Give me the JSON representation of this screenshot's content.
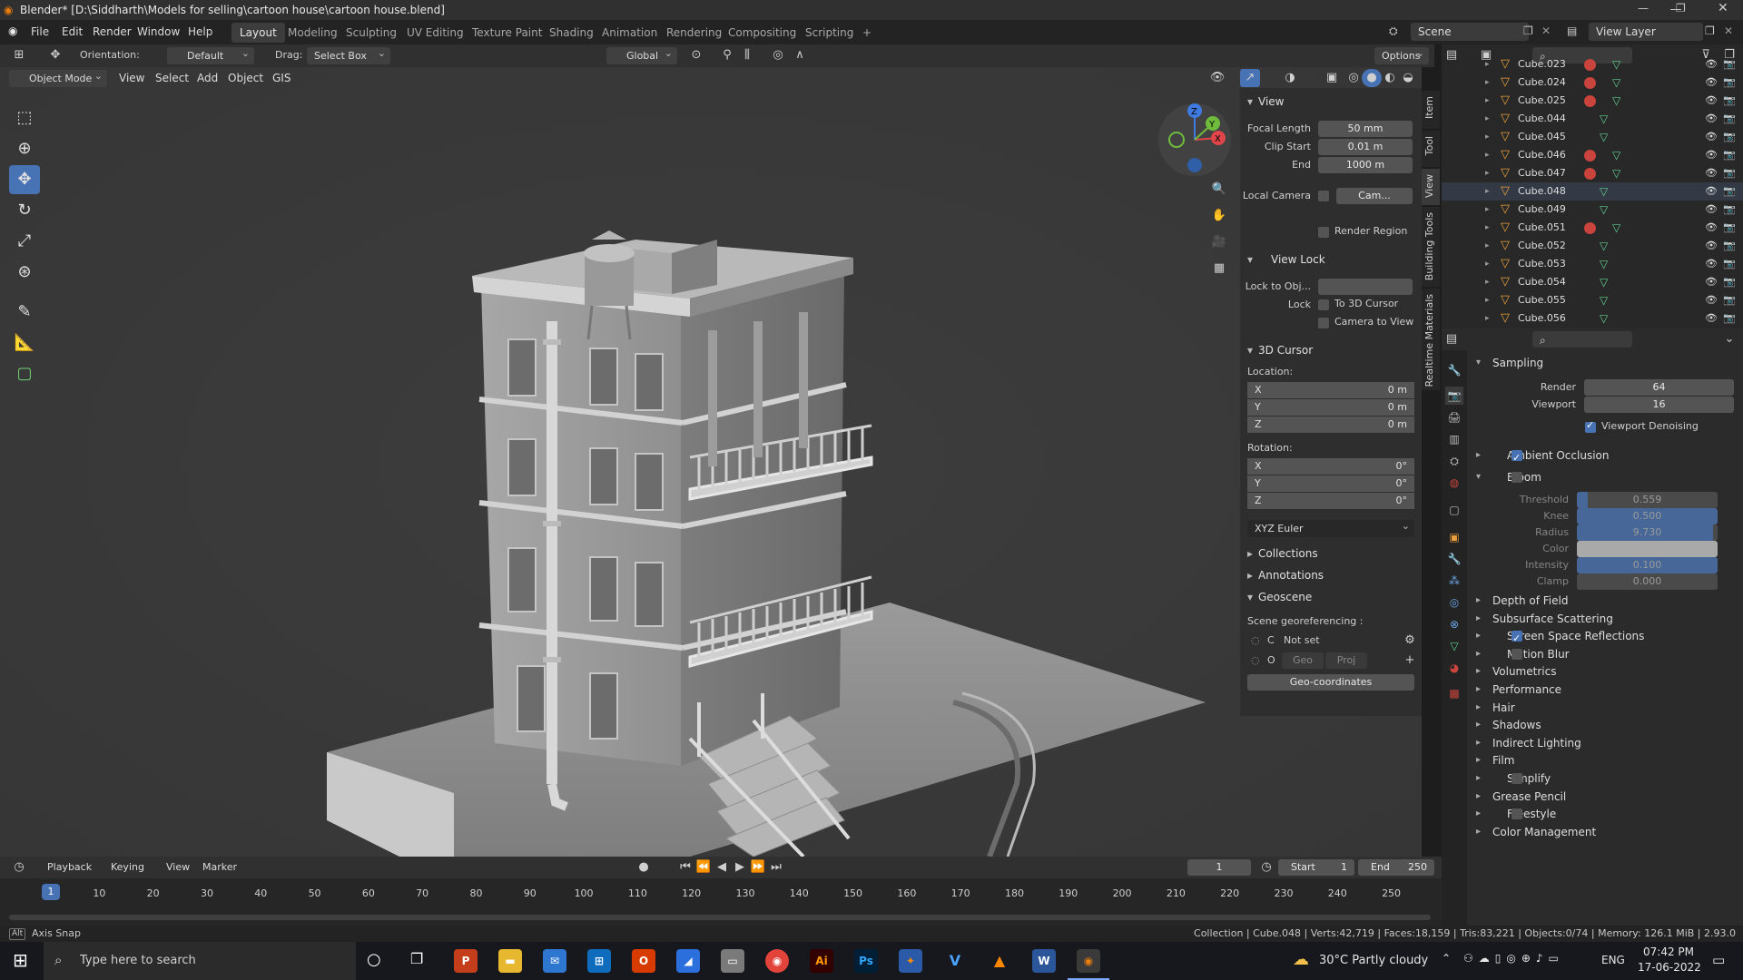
{
  "window": {
    "title": "Blender* [D:\\Siddharth\\Models for selling\\cartoon house\\cartoon house.blend]",
    "controls": [
      "minimize-icon",
      "restore-icon",
      "close-icon"
    ]
  },
  "menubar": {
    "items": [
      "File",
      "Edit",
      "Render",
      "Window",
      "Help"
    ],
    "workspaces": [
      "Layout",
      "Modeling",
      "Sculpting",
      "UV Editing",
      "Texture Paint",
      "Shading",
      "Animation",
      "Rendering",
      "Compositing",
      "Scripting",
      "+"
    ],
    "active_workspace": "Layout",
    "scene": "Scene",
    "view_layer": "View Layer"
  },
  "tool_header": {
    "orientation_label": "Orientation:",
    "orientation_value": "Default",
    "drag_label": "Drag:",
    "drag_value": "Select Box",
    "transform_orientation": "Global",
    "options": "Options"
  },
  "viewport_header": {
    "mode": "Object Mode",
    "menus": [
      "View",
      "Select",
      "Add",
      "Object",
      "GIS"
    ]
  },
  "npanel": {
    "view_section": "View",
    "focal_length_label": "Focal Length",
    "focal_length": "50 mm",
    "clip_start_label": "Clip Start",
    "clip_start": "0.01 m",
    "end_label": "End",
    "end": "1000 m",
    "local_camera_label": "Local Camera",
    "local_camera_value": "Cam...",
    "render_region": "Render Region",
    "view_lock_section": "View Lock",
    "lock_to_obj_label": "Lock to Obj...",
    "lock_label": "Lock",
    "to_3d_cursor": "To 3D Cursor",
    "camera_to_view": "Camera to View",
    "cursor_section": "3D Cursor",
    "location_label": "Location:",
    "location": [
      {
        "axis": "X",
        "value": "0 m"
      },
      {
        "axis": "Y",
        "value": "0 m"
      },
      {
        "axis": "Z",
        "value": "0 m"
      }
    ],
    "rotation_label": "Rotation:",
    "rotation": [
      {
        "axis": "X",
        "value": "0°"
      },
      {
        "axis": "Y",
        "value": "0°"
      },
      {
        "axis": "Z",
        "value": "0°"
      }
    ],
    "rotation_mode": "XYZ Euler",
    "collections": "Collections",
    "annotations": "Annotations",
    "geoscene": "Geoscene",
    "scene_georef": "Scene georeferencing :",
    "crs_letter": "C",
    "crs_value": "Not set",
    "origin_letter": "O",
    "geo_btn": "Geo",
    "proj_btn": "Proj",
    "geo_coordinates": "Geo-coordinates",
    "side_tabs": [
      "Item",
      "Tool",
      "View",
      "Building Tools",
      "Realtime Materials"
    ]
  },
  "outliner": {
    "rows": [
      {
        "name": "Cube.023",
        "mat": true,
        "mesh2": true
      },
      {
        "name": "Cube.024",
        "mat": true,
        "mesh2": true
      },
      {
        "name": "Cube.025",
        "mat": true,
        "mesh2": true
      },
      {
        "name": "Cube.044",
        "mat": false,
        "mesh2": false
      },
      {
        "name": "Cube.045",
        "mat": false,
        "mesh2": false
      },
      {
        "name": "Cube.046",
        "mat": true,
        "mesh2": true
      },
      {
        "name": "Cube.047",
        "mat": true,
        "mesh2": true
      },
      {
        "name": "Cube.048",
        "mat": false,
        "mesh2": false
      },
      {
        "name": "Cube.049",
        "mat": false,
        "mesh2": false
      },
      {
        "name": "Cube.051",
        "mat": true,
        "mesh2": true
      },
      {
        "name": "Cube.052",
        "mat": false,
        "mesh2": false
      },
      {
        "name": "Cube.053",
        "mat": false,
        "mesh2": false
      },
      {
        "name": "Cube.054",
        "mat": false,
        "mesh2": false
      },
      {
        "name": "Cube.055",
        "mat": false,
        "mesh2": false
      },
      {
        "name": "Cube.056",
        "mat": false,
        "mesh2": false
      }
    ]
  },
  "properties": {
    "sampling": "Sampling",
    "render_label": "Render",
    "render_value": "64",
    "viewport_label": "Viewport",
    "viewport_value": "16",
    "viewport_denoising": "Viewport Denoising",
    "ambient_occlusion": "Ambient Occlusion",
    "bloom": "Bloom",
    "bloom_fields": [
      {
        "label": "Threshold",
        "value": "0.559",
        "fill": 0.08
      },
      {
        "label": "Knee",
        "value": "0.500",
        "fill": 1.0
      },
      {
        "label": "Radius",
        "value": "9.730",
        "fill": 0.97
      },
      {
        "label": "Color",
        "value": "",
        "fill": 0
      },
      {
        "label": "Intensity",
        "value": "0.100",
        "fill": 1.0
      },
      {
        "label": "Clamp",
        "value": "0.000",
        "fill": 0
      }
    ],
    "sections": [
      {
        "label": "Depth of Field",
        "check": null
      },
      {
        "label": "Subsurface Scattering",
        "check": null
      },
      {
        "label": "Screen Space Reflections",
        "check": true
      },
      {
        "label": "Motion Blur",
        "check": false
      },
      {
        "label": "Volumetrics",
        "check": null
      },
      {
        "label": "Performance",
        "check": null
      },
      {
        "label": "Hair",
        "check": null
      },
      {
        "label": "Shadows",
        "check": null
      },
      {
        "label": "Indirect Lighting",
        "check": null
      },
      {
        "label": "Film",
        "check": null
      },
      {
        "label": "Simplify",
        "check": false
      },
      {
        "label": "Grease Pencil",
        "check": null
      },
      {
        "label": "Freestyle",
        "check": false
      },
      {
        "label": "Color Management",
        "check": null
      }
    ]
  },
  "timeline": {
    "menus": [
      "Playback",
      "Keying",
      "View",
      "Marker"
    ],
    "current_frame": "1",
    "start_label": "Start",
    "start": "1",
    "end_label": "End",
    "end": "250",
    "ticks": [
      "1",
      "10",
      "20",
      "30",
      "40",
      "50",
      "60",
      "70",
      "80",
      "90",
      "100",
      "110",
      "120",
      "130",
      "140",
      "150",
      "160",
      "170",
      "180",
      "190",
      "200",
      "210",
      "220",
      "230",
      "240",
      "250"
    ]
  },
  "statusbar": {
    "left": "Axis Snap",
    "right": "Collection | Cube.048 | Verts:42,719 | Faces:18,159 | Tris:83,221 | Objects:0/74 | Memory: 126.1 MiB | 2.93.0"
  },
  "taskbar": {
    "search_placeholder": "Type here to search",
    "weather": "30°C  Partly cloudy",
    "lang": "ENG",
    "time": "07:42 PM",
    "date": "17-06-2022",
    "apps": [
      "PowerPoint",
      "File Explorer",
      "Mail",
      "Store",
      "Office",
      "Blue app",
      "Settings",
      "Chrome",
      "Ai",
      "Ps",
      "App",
      "V",
      "VLC",
      "W",
      "Blender"
    ]
  }
}
